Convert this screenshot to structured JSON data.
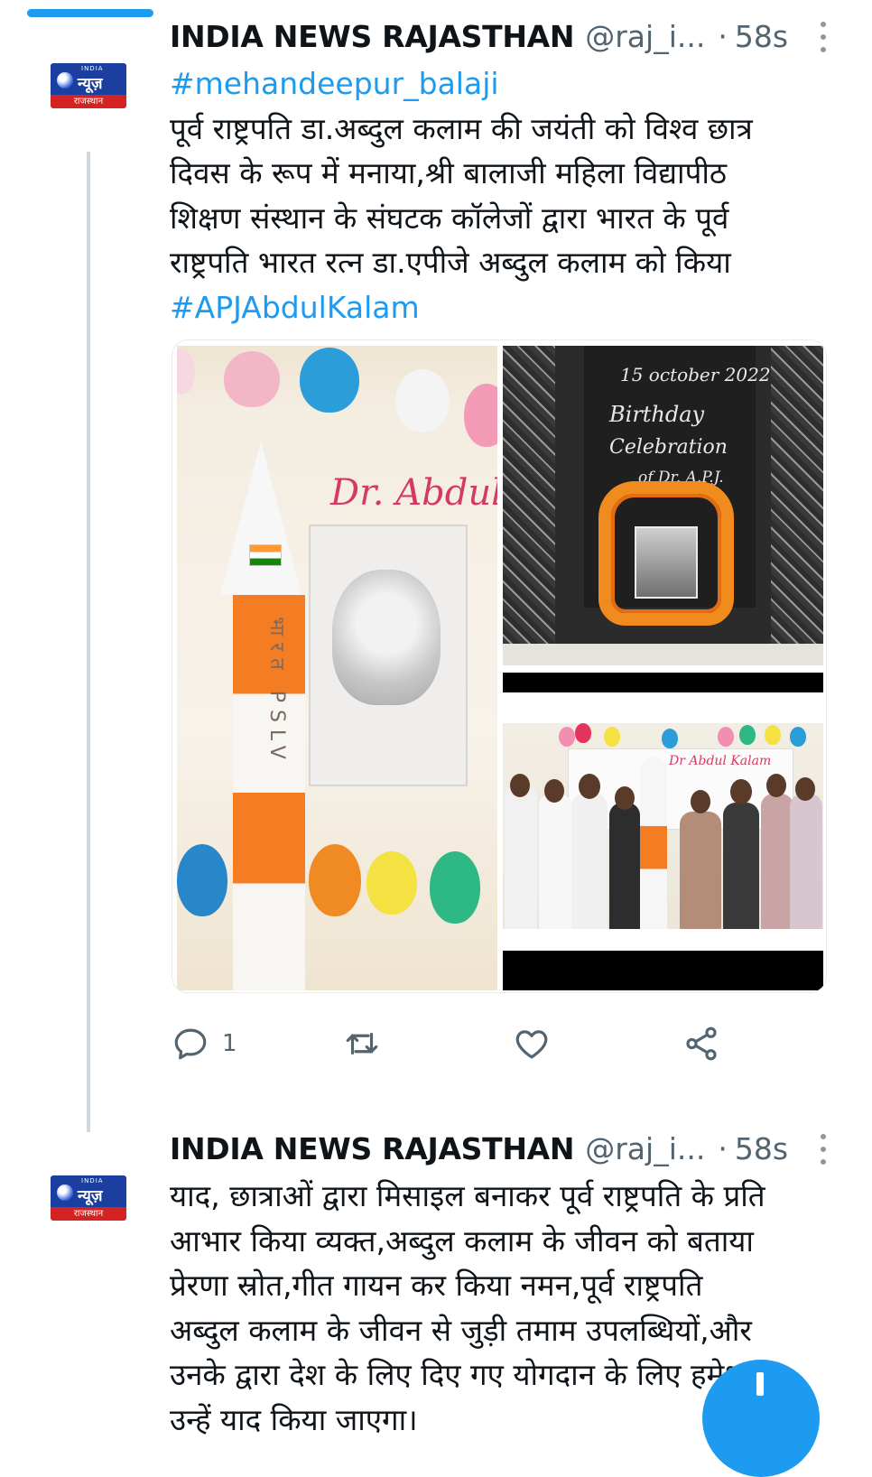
{
  "tweets": [
    {
      "author_name": "INDIA NEWS RAJASTHAN",
      "handle": "@raj_i...",
      "separator": "·",
      "time": "58s",
      "avatar": {
        "brand_small": "INDIA",
        "brand_main": "न्यूज़",
        "region": "राजस्थान"
      },
      "hashtag_top": "#mehandeepur_balaji",
      "lines": [
        "पूर्व राष्ट्रपति डा.अब्दुल कलाम की जयंती को विश्व छात्र",
        "दिवस के रूप में मनाया,श्री बालाजी महिला विद्यापीठ",
        "शिक्षण संस्थान के संघटक कॉलेजों द्वारा भारत के पूर्व",
        "राष्ट्रपति भारत रत्न डा.एपीजे अब्दुल कलाम को किया"
      ],
      "hashtag_bottom": "#APJAbdulKalam",
      "media": {
        "left_poster_title": "Dr. Abdul K",
        "rocket_label": "भारत PSLV",
        "top_right_chalk": [
          "15 october 2022",
          "Birthday",
          "Celebration",
          "of Dr. A.P.J."
        ],
        "bottom_right_banner": "Dr Abdul Kalam"
      },
      "actions": {
        "reply_count": "1"
      }
    },
    {
      "author_name": "INDIA NEWS RAJASTHAN",
      "handle": "@raj_i...",
      "separator": "·",
      "time": "58s",
      "avatar": {
        "brand_small": "INDIA",
        "brand_main": "न्यूज़",
        "region": "राजस्थान"
      },
      "lines": [
        "याद, छात्राओं द्वारा मिसाइल बनाकर पूर्व राष्ट्रपति के प्रति",
        "आभार किया व्यक्त,अब्दुल कलाम के जीवन को बताया",
        "प्रेरणा स्रोत,गीत गायन कर किया नमन,पूर्व राष्ट्रपति",
        "अब्दुल कलाम के जीवन से जुड़ी तमाम उपलब्धियों,और",
        "उनके द्वारा देश के लिए दिए गए योगदान के लिए हमेशा",
        "उन्हें याद किया जाएगा।"
      ]
    }
  ],
  "colors": {
    "accent": "#1d9bf0",
    "secondary_text": "#536471",
    "thread_line": "#cfd9de",
    "avatar_blue": "#1a3fa0",
    "avatar_red": "#d32323"
  },
  "icons": [
    "reply-icon",
    "retweet-icon",
    "like-icon",
    "share-icon",
    "more-icon"
  ]
}
